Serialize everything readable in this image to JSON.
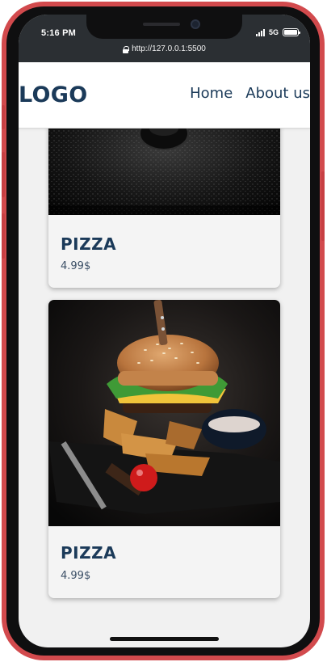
{
  "status_bar": {
    "time": "5:16 PM",
    "network": "5G",
    "url": "http://127.0.0.1:5500"
  },
  "header": {
    "logo": "LOGO",
    "nav": [
      {
        "label": "Home"
      },
      {
        "label": "About us"
      }
    ]
  },
  "cards": [
    {
      "title": "PIZZA",
      "price": "4.99$",
      "image_icon": "food-photo-dark-icon"
    },
    {
      "title": "PIZZA",
      "price": "4.99$",
      "image_icon": "burger-fries-photo-icon"
    }
  ],
  "colors": {
    "frame": "#d24a4d",
    "brand": "#1b3a59",
    "topbar": "#2b2f33",
    "page_bg": "#f1f1f1"
  }
}
